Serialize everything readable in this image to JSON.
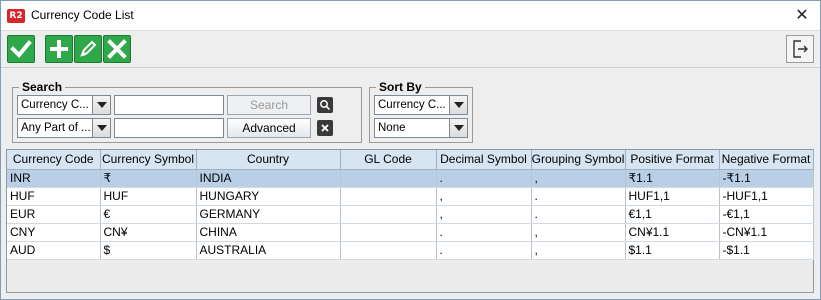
{
  "window": {
    "app_icon_text": "R2",
    "title": "Currency Code List",
    "close_glyph": "✕"
  },
  "toolbar": {
    "buttons": [
      {
        "name": "confirm-button",
        "icon": "check-icon"
      },
      {
        "name": "add-button",
        "icon": "plus-icon"
      },
      {
        "name": "edit-button",
        "icon": "pencil-icon"
      },
      {
        "name": "delete-button",
        "icon": "x-icon"
      }
    ],
    "exit_icon": "exit-icon",
    "accent_color": "#2fa84a"
  },
  "search": {
    "label": "Search",
    "field_select": "Currency C...",
    "match_select": "Any Part of ...",
    "search_value": "",
    "filter_value": "",
    "search_button": "Search",
    "advanced_button": "Advanced"
  },
  "sort": {
    "label": "Sort By",
    "primary": "Currency C...",
    "secondary": "None"
  },
  "table": {
    "columns": [
      "Currency Code",
      "Currency Symbol",
      "Country",
      "GL Code",
      "Decimal Symbol",
      "Grouping Symbol",
      "Positive Format",
      "Negative Format"
    ],
    "rows": [
      [
        "INR",
        "₹",
        "INDIA",
        "",
        ".",
        ",",
        "₹1.1",
        "-₹1.1"
      ],
      [
        "HUF",
        "HUF",
        "HUNGARY",
        "",
        ",",
        ".",
        "HUF1,1",
        "-HUF1,1"
      ],
      [
        "EUR",
        "€",
        "GERMANY",
        "",
        ",",
        ".",
        "€1,1",
        "-€1,1"
      ],
      [
        "CNY",
        "CN¥",
        "CHINA",
        "",
        ".",
        ",",
        "CN¥1.1",
        "-CN¥1.1"
      ],
      [
        "AUD",
        "$",
        "AUSTRALIA",
        "",
        ".",
        ",",
        "$1.1",
        "-$1.1"
      ]
    ],
    "selected_row": 0
  }
}
